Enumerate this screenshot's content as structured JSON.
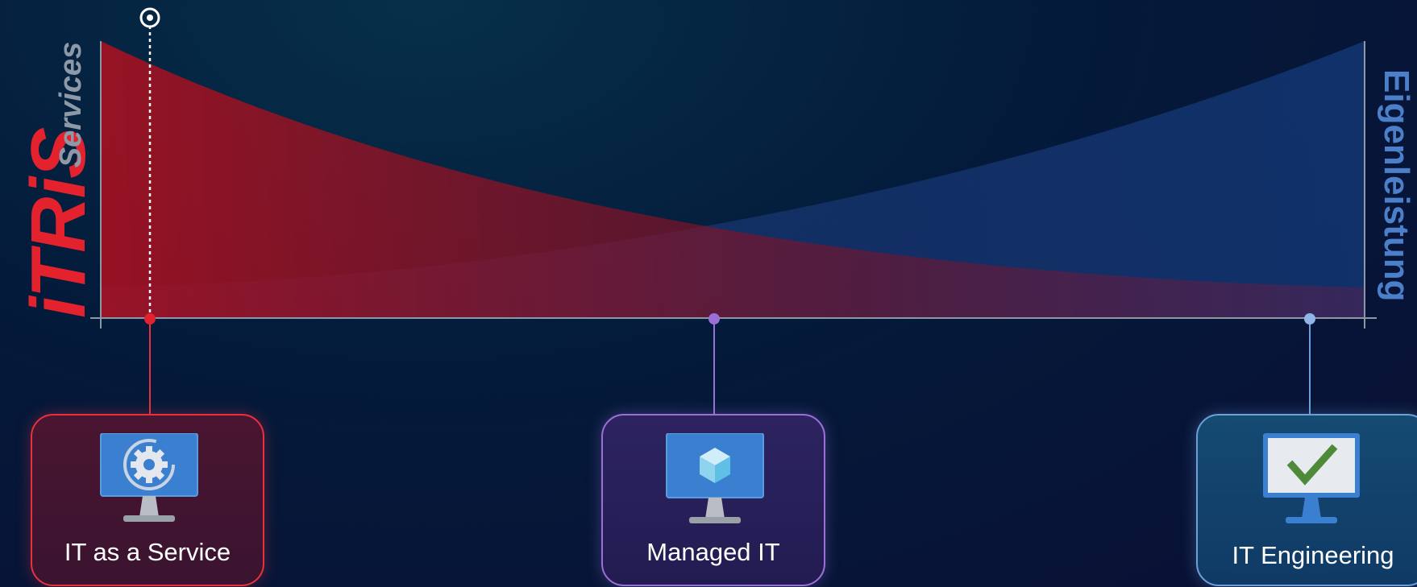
{
  "logo": {
    "brand": "iTRiS",
    "sub": "Services"
  },
  "right_axis_label": "Eigenleistung",
  "colors": {
    "red": "#e3222e",
    "purple": "#9a6fd6",
    "blue": "#6da0d8",
    "axis": "#8d97a6"
  },
  "stages": [
    {
      "label": "IT as a Service",
      "icon": "monitor-gear-icon",
      "color": "#e8313c"
    },
    {
      "label": "Managed IT",
      "icon": "monitor-cube-icon",
      "color": "#9a6fd6"
    },
    {
      "label": "IT Engineering",
      "icon": "monitor-checkmark-icon",
      "color": "#6da0d8"
    }
  ],
  "marker": {
    "icon": "target-pin-icon"
  }
}
